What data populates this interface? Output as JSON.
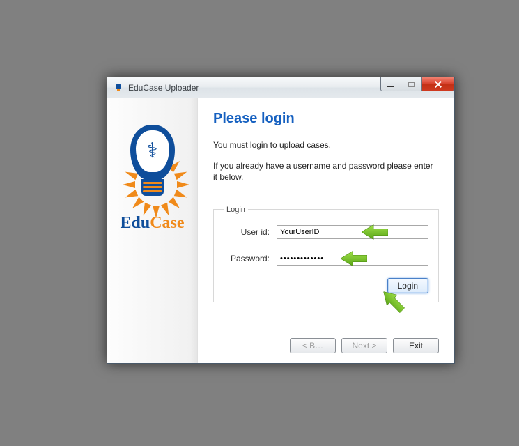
{
  "window": {
    "title": "EduCase Uploader"
  },
  "brand": {
    "part1": "Edu",
    "part2": "Case"
  },
  "main": {
    "heading": "Please login",
    "intro1": "You must login to upload cases.",
    "intro2": "If you already have a username and password please enter it below."
  },
  "login": {
    "legend": "Login",
    "userid_label": "User id:",
    "userid_value": "YourUserID",
    "password_label": "Password:",
    "password_value": "•••••••••••••",
    "login_btn": "Login"
  },
  "footer": {
    "back": "< B…",
    "next": "Next >",
    "exit": "Exit"
  },
  "colors": {
    "accent": "#1560c0",
    "orange": "#f08a1a",
    "blue": "#0f4e9b"
  }
}
